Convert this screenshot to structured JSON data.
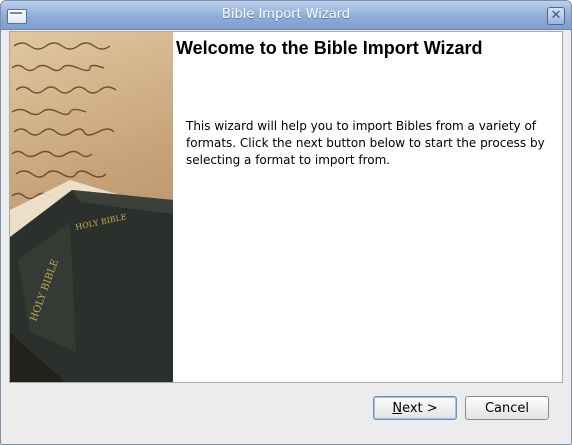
{
  "window": {
    "title": "Bible Import Wizard"
  },
  "page": {
    "heading": "Welcome to the Bible Import Wizard",
    "description": "This wizard will help you to import Bibles from a variety of formats. Click the next button below to start the process by selecting a format to import from."
  },
  "side_image": {
    "book_text_1": "HOLY BIBLE",
    "book_text_2": "HOLY BIBLE"
  },
  "buttons": {
    "next_mnemonic": "N",
    "next_rest": "ext >",
    "cancel": "Cancel"
  },
  "icons": {
    "window_icon": "window-icon",
    "close": "close-icon"
  },
  "colors": {
    "titlebar": "#8eacd8",
    "background": "#ececec",
    "content": "#ffffff"
  }
}
